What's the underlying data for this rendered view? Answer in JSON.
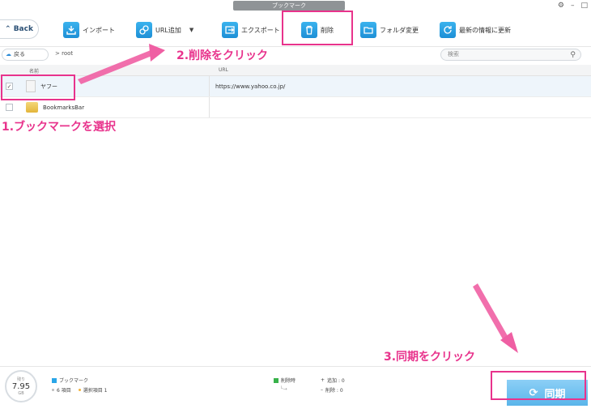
{
  "window": {
    "title": "ブックマーク"
  },
  "toolbar": {
    "back_label": "Back",
    "import_label": "インポート",
    "add_url_label": "URL追加",
    "export_label": "エクスポート",
    "delete_label": "削除",
    "change_folder_label": "フォルダ変更",
    "refresh_label": "最新の情報に更新"
  },
  "pathbar": {
    "back_label": "戻る",
    "path": "> root",
    "search_placeholder": "検索"
  },
  "table": {
    "headers": [
      "名前",
      "URL"
    ],
    "rows": [
      {
        "name": "ヤフー",
        "url": "https://www.yahoo.co.jp/",
        "checked": true,
        "type": "file"
      },
      {
        "name": "BookmarksBar",
        "url": "",
        "checked": false,
        "type": "folder"
      }
    ]
  },
  "annotations": {
    "step1": "1.ブックマークを選択",
    "step2": "2.削除をクリック",
    "step3": "3.同期をクリック"
  },
  "footer": {
    "disk_label": "残り",
    "disk_value": "7.95",
    "disk_unit": "GB",
    "bookmark_label": "ブックマーク",
    "items_count": "6 項目",
    "selected_count": "選択項目 1",
    "sync_delete_label": "削除時",
    "added_label": "追加 : 0",
    "deleted_label": "削除 : 0",
    "sync_button_label": "同期"
  },
  "colors": {
    "accent": "#e8338c",
    "primary": "#1d8fd6",
    "sync": "#5ab5ea"
  }
}
